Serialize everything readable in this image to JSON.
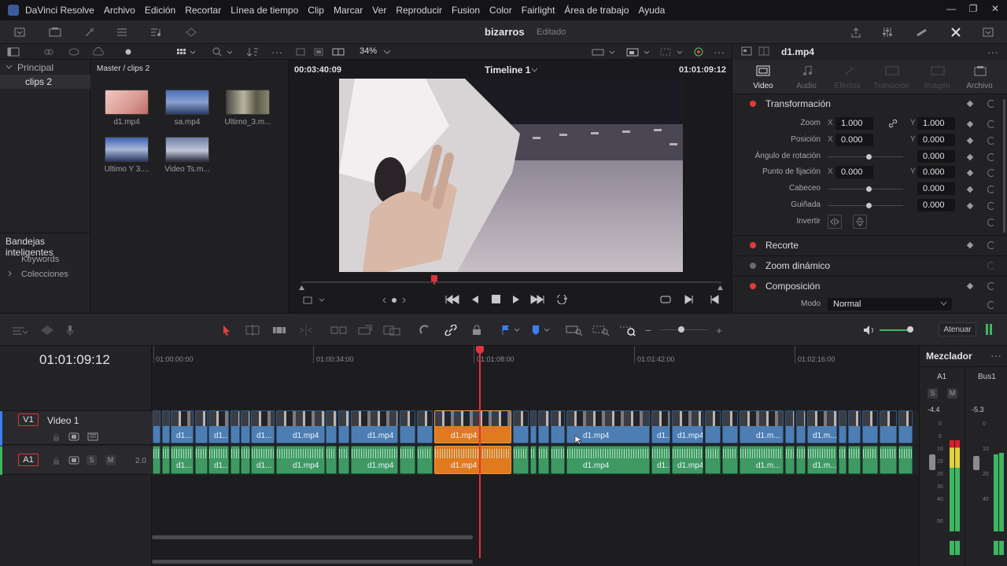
{
  "app": {
    "name": "DaVinci Resolve",
    "menu": [
      "Archivo",
      "Edición",
      "Recortar",
      "Línea de tiempo",
      "Clip",
      "Marcar",
      "Ver",
      "Reproducir",
      "Fusion",
      "Color",
      "Fairlight",
      "Área de trabajo",
      "Ayuda"
    ],
    "window_controls": [
      "—",
      "❐",
      "✕"
    ]
  },
  "project": {
    "name": "bizarros",
    "status": "Editado"
  },
  "viewer_bar": {
    "zoom": "34%"
  },
  "bins": {
    "root": "Principal",
    "selected": "clips 2",
    "smart_bins_title": "Bandejas inteligentes",
    "smart_items": [
      "Keywords",
      "Colecciones"
    ]
  },
  "media_pool": {
    "path": "Master / clips 2",
    "clips": [
      "d1.mp4",
      "sa.mp4",
      "Ultimo_3.m...",
      "Ultimo Y 3....",
      "Video Ts.m..."
    ]
  },
  "viewer": {
    "source_timecode": "00:03:40:09",
    "timeline_name": "Timeline 1",
    "record_timecode": "01:01:09:12"
  },
  "inspector": {
    "clip_name": "d1.mp4",
    "tabs": [
      "Video",
      "Audio",
      "Efectos",
      "Transición",
      "Imagen",
      "Archivo"
    ],
    "active_tab": "Video",
    "sections": {
      "transform": "Transformación",
      "crop": "Recorte",
      "dynamic_zoom": "Zoom dinámico",
      "composite": "Composición"
    },
    "params": {
      "zoom": {
        "label": "Zoom",
        "x": "1.000",
        "y": "1.000"
      },
      "position": {
        "label": "Posición",
        "x": "0.000",
        "y": "0.000"
      },
      "rotation": {
        "label": "Ángulo de rotación",
        "value": "0.000"
      },
      "anchor": {
        "label": "Punto de fijación",
        "x": "0.000",
        "y": "0.000"
      },
      "pitch": {
        "label": "Cabeceo",
        "value": "0.000"
      },
      "yaw": {
        "label": "Guiñada",
        "value": "0.000"
      },
      "flip": {
        "label": "Invertir"
      }
    },
    "axis_x": "X",
    "axis_y": "Y",
    "mode_label": "Modo",
    "mode_value": "Normal"
  },
  "timeline": {
    "timecode": "01:01:09:12",
    "ruler": [
      "01:00:00:00",
      "01:00:34:00",
      "01:01:08:00",
      "01:01:42:00",
      "01:02:16:00"
    ],
    "video_track": {
      "id": "V1",
      "name": "Video 1"
    },
    "audio_track": {
      "id": "A1",
      "level": "2.0",
      "solo": "S",
      "mute": "M"
    },
    "clip_short": "d1...",
    "clip_full": "d1.mp4",
    "clip_trunc": "d1.m..."
  },
  "audio_controls": {
    "mute_label": "Atenuar"
  },
  "mixer": {
    "title": "Mezclador",
    "channels": [
      "A1",
      "Bus1"
    ],
    "solo": "S",
    "mute": "M",
    "a1_level": "-4.4",
    "bus_level": "-5.3",
    "scale": [
      "0",
      "5",
      "10",
      "15",
      "20",
      "30",
      "40",
      "50"
    ]
  },
  "colors": {
    "video_clip": "#4d7eb3",
    "audio_clip": "#3e9a62",
    "selected_clip": "#e07a1f",
    "playhead": "#e0333a"
  }
}
